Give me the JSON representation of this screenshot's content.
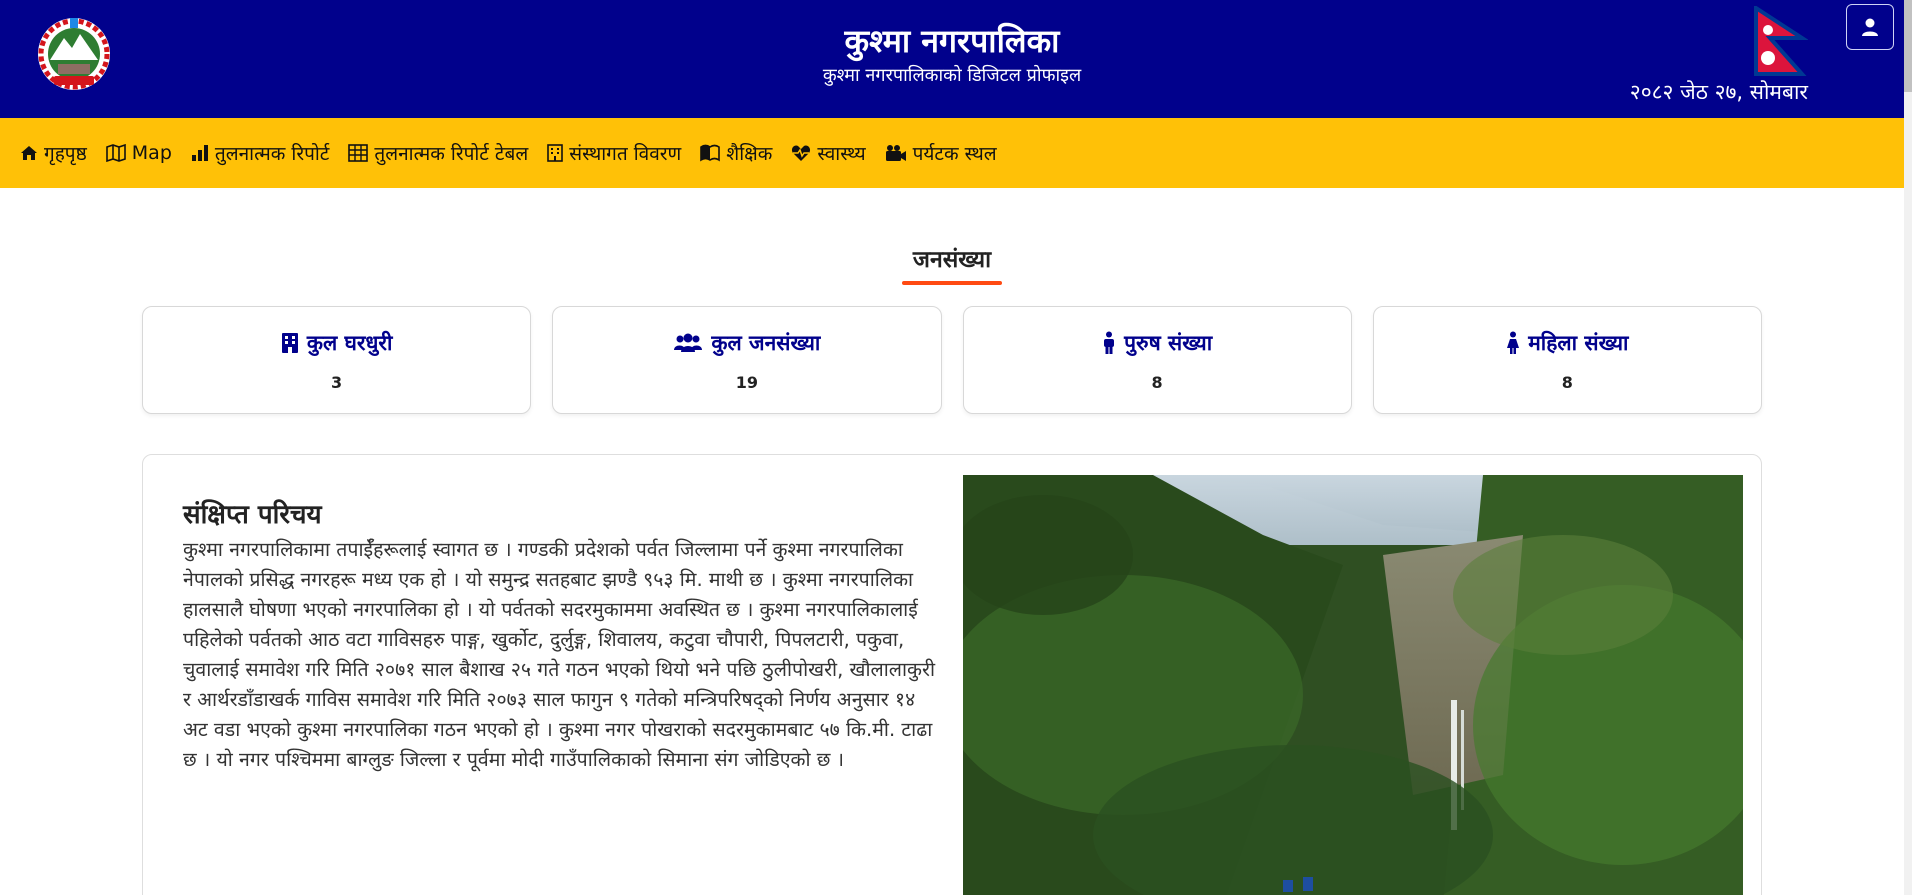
{
  "header": {
    "title": "कुश्मा नगरपालिका",
    "subtitle": "कुश्मा नगरपालिकाको डिजिटल प्रोफाइल",
    "date": "२०८२ जेठ २७, सोमबार",
    "emblem_icon": "nepal-government-emblem",
    "flag_icon": "nepal-flag",
    "user_icon": "user-icon",
    "colors": {
      "header_bg": "#01018c",
      "nav_bg": "#ffc107",
      "accent": "#ff4a12"
    }
  },
  "nav": {
    "items": [
      {
        "label": "गृहपृष्ठ",
        "icon": "home-icon"
      },
      {
        "label": "Map",
        "icon": "map-icon"
      },
      {
        "label": "तुलनात्मक रिपोर्ट",
        "icon": "bar-chart-icon"
      },
      {
        "label": "तुलनात्मक रिपोर्ट टेबल",
        "icon": "table-icon"
      },
      {
        "label": "संस्थागत विवरण",
        "icon": "building-icon"
      },
      {
        "label": "शैक्षिक",
        "icon": "book-icon"
      },
      {
        "label": "स्वास्थ्य",
        "icon": "heart-pulse-icon"
      },
      {
        "label": "पर्यटक स्थल",
        "icon": "camera-icon"
      }
    ]
  },
  "population": {
    "title": "जनसंख्या",
    "cards": [
      {
        "label": "कुल घरधुरी",
        "value": "3",
        "icon": "building-icon"
      },
      {
        "label": "कुल जनसंख्या",
        "value": "19",
        "icon": "users-icon"
      },
      {
        "label": "पुरुष संख्या",
        "value": "8",
        "icon": "male-icon"
      },
      {
        "label": "महिला संख्या",
        "value": "8",
        "icon": "female-icon"
      }
    ]
  },
  "intro": {
    "title": "संक्षिप्त परिचय",
    "text": "कुश्मा नगरपालिकामा तपाईँहरूलाई स्वागत छ । गण्डकी प्रदेशको पर्वत जिल्लामा पर्ने कुश्मा नगरपालिका नेपालको प्रसिद्ध नगरहरू मध्य एक हो । यो समुन्द्र सतहबाट झण्डै ९५३ मि. माथी छ । कुश्मा नगरपालिका हालसालै घोषणा भएको नगरपालिका हो । यो पर्वतको सदरमुकाममा अवस्थित छ । कुश्मा नगरपालिकालाई पहिलेको पर्वतको आठ वटा गाविसहरु पाङ्ग, खुर्कोट, दुर्लुङ्ग, शिवालय, कटुवा चौपारी, पिपलटारी, पकुवा, चुवालाई समावेश गरि मिति २०७१ साल बैशाख २५ गते गठन भएको थियो भने पछि ठुलीपोखरी, खौलालाकुरी र आर्थरडाँडाखर्क गाविस समावेश गरि मिति २०७३ साल फागुन ९ गतेको मन्त्रिपरिषद्को निर्णय अनुसार १४ अट वडा भएको कुश्मा नगरपालिका गठन भएको हो । कुश्मा नगर पोखराको सदरमुकामबाट ५७ कि.मी. टाढा छ । यो नगर पश्चिममा बाग्लुङ जिल्ला र पूर्वमा मोदी गाउँपालिकाको सिमाना संग जोडिएको छ ।",
    "photo": "waterfall-forest-photo"
  }
}
